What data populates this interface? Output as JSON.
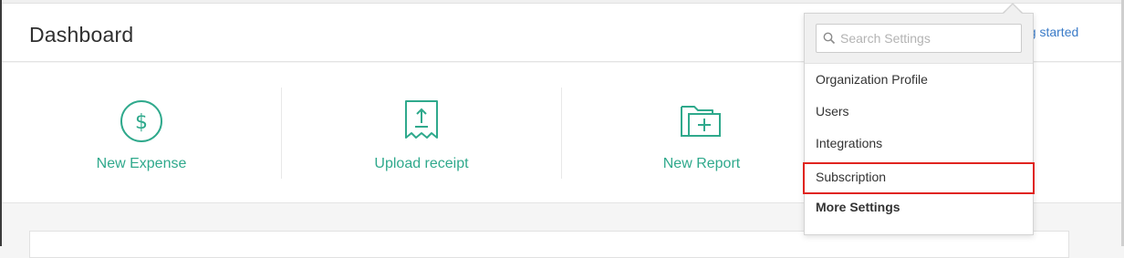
{
  "header": {
    "title": "Dashboard",
    "getting_started_label": "ng started"
  },
  "quick_actions": [
    {
      "label": "New Expense",
      "icon": "dollar-circle-icon"
    },
    {
      "label": "Upload receipt",
      "icon": "upload-receipt-icon"
    },
    {
      "label": "New Report",
      "icon": "add-folder-icon"
    }
  ],
  "settings_menu": {
    "search_placeholder": "Search Settings",
    "search_value": "",
    "items": [
      {
        "label": "Organization Profile"
      },
      {
        "label": "Users"
      },
      {
        "label": "Integrations"
      },
      {
        "label": "Subscription",
        "highlighted": true
      },
      {
        "label": "More Settings",
        "bold": true
      }
    ]
  },
  "colors": {
    "accent_green": "#2fa98c",
    "link_blue": "#3a7bc8",
    "highlight_red": "#e0241f"
  }
}
